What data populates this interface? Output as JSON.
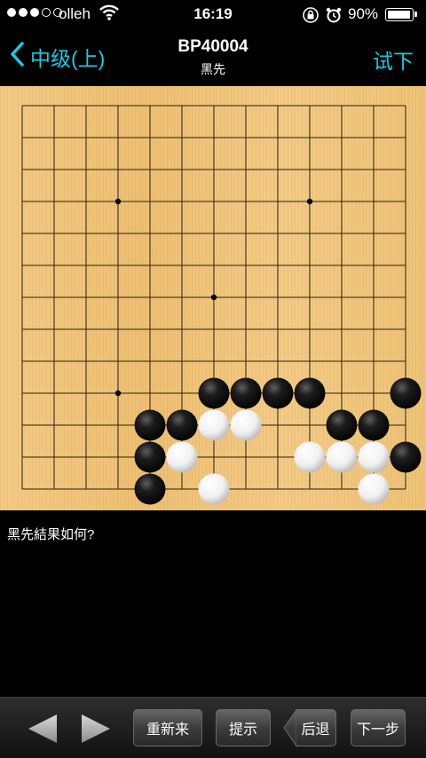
{
  "status_bar": {
    "carrier": "olleh",
    "time": "16:19",
    "battery": "90%"
  },
  "nav": {
    "back_label": "中级(上)",
    "title": "BP40004",
    "subtitle": "黑先",
    "try_label": "试下"
  },
  "board": {
    "grid_lines": 13,
    "star_points": [
      [
        3,
        3
      ],
      [
        9,
        3
      ],
      [
        6,
        6
      ],
      [
        3,
        9
      ]
    ],
    "black_stones": [
      [
        6,
        9
      ],
      [
        7,
        9
      ],
      [
        8,
        9
      ],
      [
        9,
        9
      ],
      [
        12,
        9
      ],
      [
        4,
        10
      ],
      [
        5,
        10
      ],
      [
        10,
        10
      ],
      [
        11,
        10
      ],
      [
        4,
        11
      ],
      [
        12,
        11
      ],
      [
        4,
        12
      ]
    ],
    "white_stones": [
      [
        6,
        10
      ],
      [
        7,
        10
      ],
      [
        5,
        11
      ],
      [
        9,
        11
      ],
      [
        10,
        11
      ],
      [
        11,
        11
      ],
      [
        6,
        12
      ],
      [
        11,
        12
      ]
    ]
  },
  "question": "黑先結果如何?",
  "toolbar": {
    "restart": "重新来",
    "hint": "提示",
    "undo": "后退",
    "next": "下一步"
  }
}
